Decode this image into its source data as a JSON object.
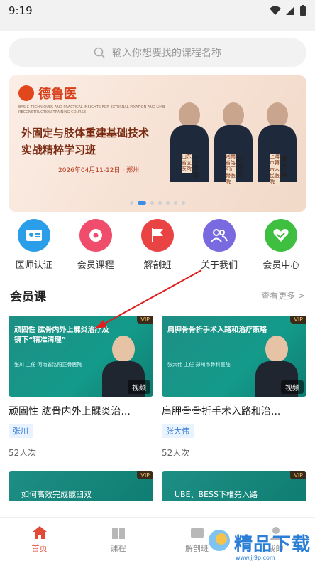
{
  "status": {
    "time": "9:19"
  },
  "search": {
    "placeholder": "输入你想要找的课程名称"
  },
  "banner": {
    "logo": "德鲁医",
    "subtitle": "BASIC TECHNIQUES AND PRACTICAL INSIGHTS FOR EXTERNAL FIXATION AND LIMB RECONSTRUCTION TRAINING COURSE",
    "title_line1": "外固定与肢体重建基础技术",
    "title_line2": "实战精粹学习班",
    "date": "2026年04月11-12日 · 郑州",
    "people": [
      {
        "tag": "山东省立医院",
        "name": "王永会",
        "role": "教授"
      },
      {
        "tag": "河南省洛阳正骨医院",
        "name": "杜志军",
        "role": "教授"
      },
      {
        "tag": "上海市第六人民医院",
        "name": "康庆林",
        "role": "教授"
      }
    ]
  },
  "quick_links": [
    {
      "label": "医师认证",
      "color": "#2a9ee8",
      "icon": "id-card-icon"
    },
    {
      "label": "会员课程",
      "color": "#ef4d6b",
      "icon": "flower-icon"
    },
    {
      "label": "解剖班",
      "color": "#e94343",
      "icon": "flag-icon"
    },
    {
      "label": "关于我们",
      "color": "#7a6ae0",
      "icon": "users-icon"
    },
    {
      "label": "会员中心",
      "color": "#3fbf3f",
      "icon": "heart-check-icon"
    }
  ],
  "members": {
    "section_title": "会员课",
    "more": "查看更多 >",
    "courses": [
      {
        "thumb_title": "顽固性 肱骨内外上髁炎治疗及镜下“精准清理”",
        "thumb_sub": "张川 主任 河南省洛阳正骨医院",
        "vip": "VIP",
        "badge": "视频",
        "title": "顽固性 肱骨内外上髁炎治...",
        "teacher": "张川",
        "count": "52人次"
      },
      {
        "thumb_title": "肩胛骨骨折手术入路和治疗策略",
        "thumb_sub": "张大伟 主任 郑州市骨科医院",
        "vip": "VIP",
        "badge": "视频",
        "title": "肩胛骨骨折手术入路和治...",
        "teacher": "张大伟",
        "count": "52人次"
      }
    ],
    "next_courses": [
      {
        "thumb_title": "如何高效完成髋臼双",
        "vip": "VIP"
      },
      {
        "thumb_title": "UBE、BESS下椎旁入路",
        "vip": "VIP"
      }
    ]
  },
  "tabbar": [
    {
      "label": "首页",
      "active": true
    },
    {
      "label": "课程",
      "active": false
    },
    {
      "label": "解剖班",
      "active": false
    },
    {
      "label": "我的",
      "active": false
    }
  ],
  "watermark": {
    "text": "精品下载",
    "url": "www.jj9p.com"
  },
  "colors": {
    "accent": "#e24a36",
    "teal": "#149a8a",
    "tag_blue": "#3b7fd6"
  }
}
